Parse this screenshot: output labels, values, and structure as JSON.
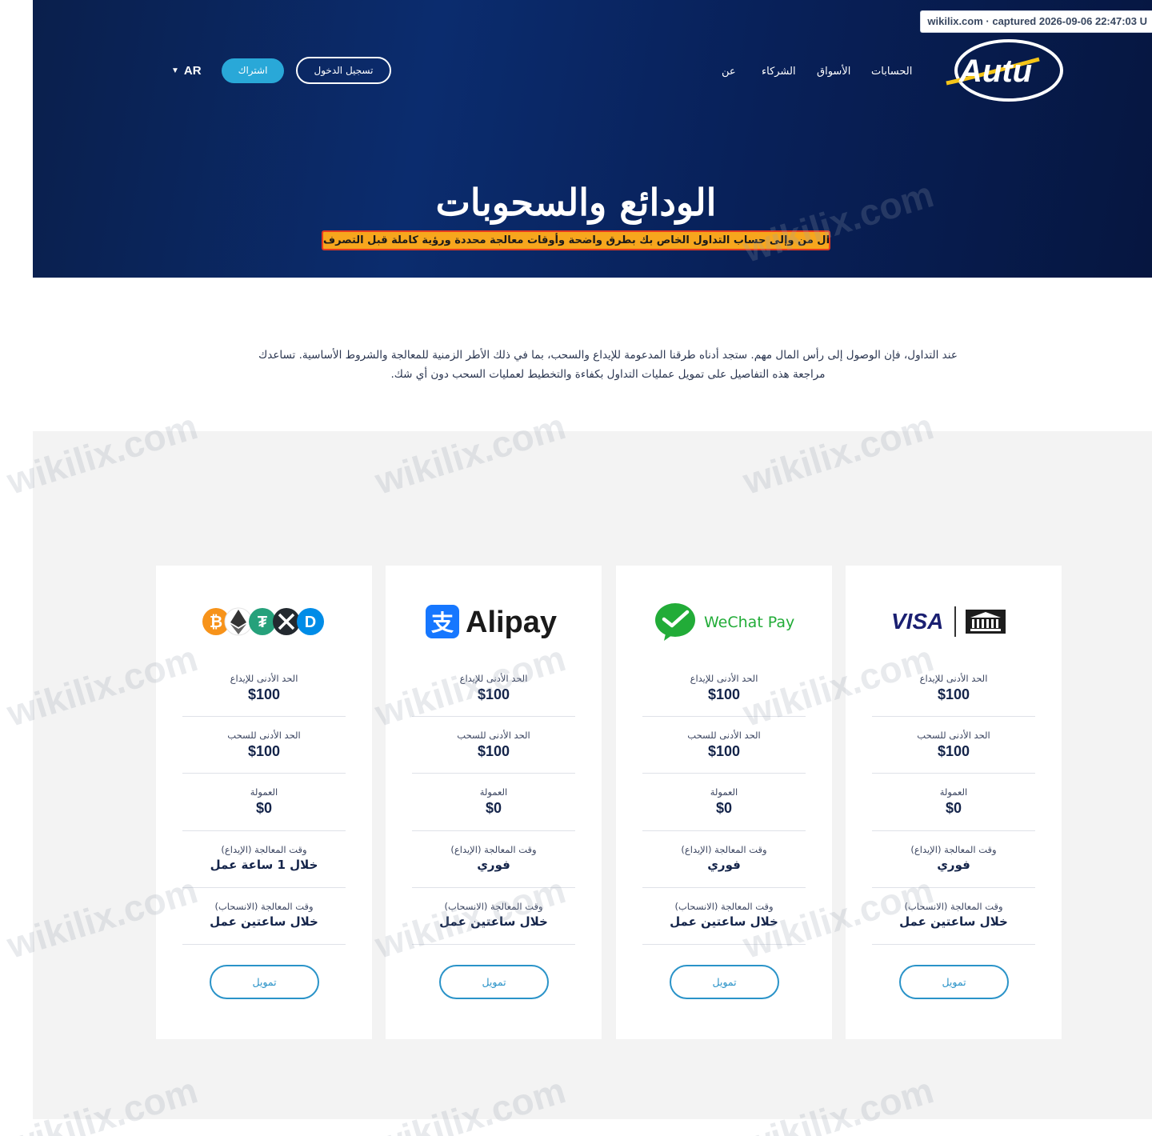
{
  "capture_tag": "wikilix.com · captured 2026-09-06 22:47:03 U",
  "brand": {
    "logo_text": "Autu"
  },
  "nav": {
    "items": [
      "الحسابات",
      "الأسواق",
      "الشركاء",
      "عن"
    ],
    "login_label": "تسجيل الدخول",
    "subscribe_label": "اشتراك",
    "language": "AR"
  },
  "hero": {
    "title": "الودائع والسحوبات",
    "subtitle": "قم بنقل الأموال من وإلى حساب التداول الخاص بك بطرق واضحة وأوقات معالجة محددة ورؤية كاملة قبل التصرف."
  },
  "intro": {
    "line1": "عند التداول، فإن الوصول إلى رأس المال مهم. ستجد أدناه طرقنا المدعومة للإيداع والسحب، بما في ذلك الأطر الزمنية للمعالجة والشروط الأساسية. تساعدك",
    "line2": "مراجعة هذه التفاصيل على تمويل عمليات التداول بكفاءة والتخطيط لعمليات السحب دون أي شك."
  },
  "labels": {
    "min_deposit": "الحد الأدنى للإيداع",
    "min_withdraw": "الحد الأدنى للسحب",
    "commission": "العمولة",
    "deposit_time": "وقت المعالجة (الإيداع)",
    "withdraw_time": "وقت المعالجة (الانسحاب)",
    "fund_button": "تمويل"
  },
  "methods": [
    {
      "name": "Crypto",
      "min_deposit": "$100",
      "min_withdraw": "$100",
      "commission": "$0",
      "deposit_time": "خلال 1 ساعة عمل",
      "withdraw_time": "خلال ساعتين عمل"
    },
    {
      "name": "Alipay",
      "min_deposit": "$100",
      "min_withdraw": "$100",
      "commission": "$0",
      "deposit_time": "فوري",
      "withdraw_time": "خلال ساعتين عمل"
    },
    {
      "name": "WeChat Pay",
      "min_deposit": "$100",
      "min_withdraw": "$100",
      "commission": "$0",
      "deposit_time": "فوري",
      "withdraw_time": "خلال ساعتين عمل"
    },
    {
      "name": "VISA",
      "min_deposit": "$100",
      "min_withdraw": "$100",
      "commission": "$0",
      "deposit_time": "فوري",
      "withdraw_time": "خلال ساعتين عمل"
    }
  ],
  "watermark": "wikilix.com",
  "colors": {
    "hero": "#0a2560",
    "accent": "#29a8d8",
    "highlight": "#f7a61d",
    "fund": "#2a93c8"
  }
}
